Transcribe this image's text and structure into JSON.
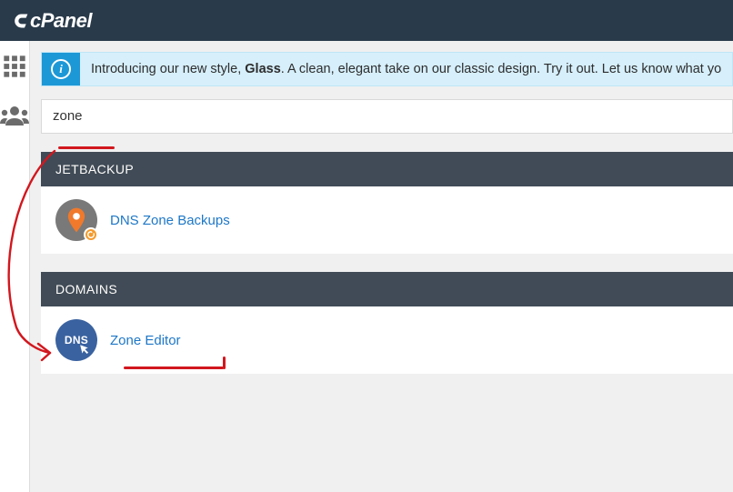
{
  "brand": "cPanel",
  "banner": {
    "prefix": "Introducing our new style, ",
    "bold": "Glass",
    "suffix": ". A clean, elegant take on our classic design. Try it out. Let us know what yo"
  },
  "search": {
    "value": "zone"
  },
  "groups": [
    {
      "title": "JETBACKUP",
      "items": [
        {
          "label": "DNS Zone Backups",
          "icon": "dns-backup-icon"
        }
      ]
    },
    {
      "title": "DOMAINS",
      "items": [
        {
          "label": "Zone Editor",
          "icon": "zone-editor-icon"
        }
      ]
    }
  ],
  "sidebar": {
    "items": [
      "apps-grid-icon",
      "users-icon"
    ]
  }
}
